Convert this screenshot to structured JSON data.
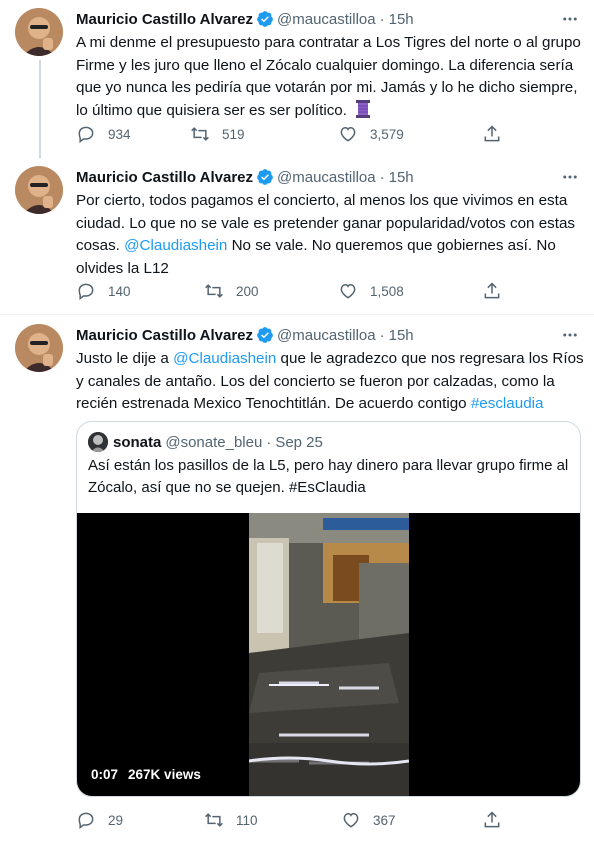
{
  "tweets": [
    {
      "author": "Mauricio Castillo Alvarez",
      "handle": "@maucastilloa",
      "separator": "·",
      "time": "15h",
      "text": "A mi denme el presupuesto para contratar a Los Tigres del norte o al grupo Firme y les juro que lleno el Zócalo cualquier  domingo. La diferencia sería que yo nunca les pediría que votarán por mi. Jamás y lo he dicho siempre, lo último que quisiera ser es ser político.",
      "emoji_icon": "purple-thread-emoji",
      "replies": "934",
      "retweets": "519",
      "likes": "3,579"
    },
    {
      "author": "Mauricio Castillo Alvarez",
      "handle": "@maucastilloa",
      "separator": "·",
      "time": "15h",
      "text_before": "Por cierto, todos pagamos el concierto, al menos los que vivimos en esta ciudad. Lo que no se vale es pretender ganar popularidad/votos con estas cosas. ",
      "mention": "@Claudiashein",
      "text_after": " No se vale. No queremos que gobiernes así. No olvides la L12",
      "replies": "140",
      "retweets": "200",
      "likes": "1,508"
    },
    {
      "author": "Mauricio Castillo Alvarez",
      "handle": "@maucastilloa",
      "separator": "·",
      "time": "15h",
      "text_before": "Justo le dije a ",
      "mention": "@Claudiashein",
      "text_after": " que le agradezco que nos regresara los Ríos y canales de antaño. Los del concierto se fueron por calzadas, como la recién estrenada Mexico Tenochtitlán. De acuerdo contigo ",
      "hashtag": "#esclaudia",
      "replies": "29",
      "retweets": "110",
      "likes": "367",
      "quote": {
        "author": "sonata",
        "handle": "@sonate_bleu",
        "separator": "·",
        "date": "Sep 25",
        "text": "Así están los pasillos de la L5, pero hay dinero para llevar grupo firme al Zócalo, así que no se quejen. #EsClaudia",
        "video_time": "0:07",
        "video_views": "267K views"
      }
    }
  ],
  "colors": {
    "text": "#0f1419",
    "secondary": "#536471",
    "link": "#1d9bf0",
    "verified": "#1d9bf0",
    "border": "#cfd9de"
  }
}
